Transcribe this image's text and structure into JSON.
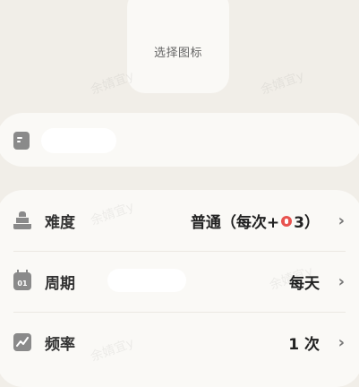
{
  "icon_picker": {
    "label": "选择图标",
    "icon": "icon-placeholder"
  },
  "name_field": {
    "icon": "note-icon",
    "value": ""
  },
  "settings": {
    "difficulty": {
      "label": "难度",
      "icon": "difficulty-icon",
      "value_prefix": "普通（每次+",
      "value_suffix": "3）",
      "coin_icon": "coin-icon",
      "coin_color": "#e8534f"
    },
    "period": {
      "label": "周期",
      "icon": "calendar-icon",
      "icon_text": "01",
      "value": "每天"
    },
    "frequency": {
      "label": "频率",
      "icon": "trend-icon",
      "value": "1 次"
    }
  },
  "watermark": "余婧宜y"
}
